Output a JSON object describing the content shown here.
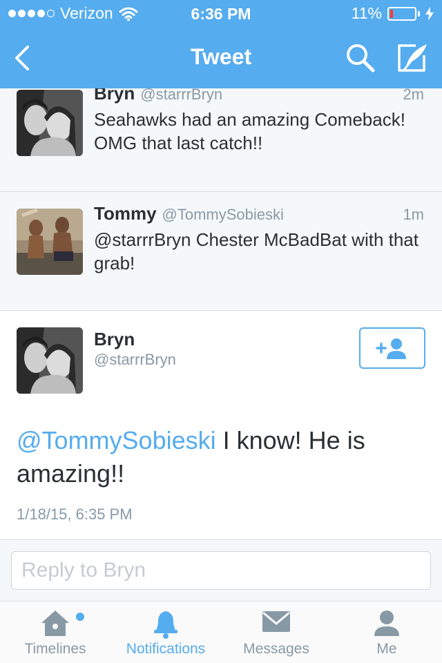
{
  "status_bar": {
    "carrier": "Verizon",
    "time": "6:36 PM",
    "battery_percent": "11%",
    "battery_level": 0.11,
    "battery_color": "#ff3b30"
  },
  "nav": {
    "title": "Tweet",
    "back_icon": "chevron-left-icon",
    "search_icon": "search-icon",
    "compose_icon": "compose-icon"
  },
  "tweets": [
    {
      "name": "Bryn",
      "handle": "@starrrBryn",
      "time": "2m",
      "text": "Seahawks had an amazing Comeback! OMG that last catch!!"
    },
    {
      "name": "Tommy",
      "handle": "@TommySobieski",
      "time": "1m",
      "text": "@starrrBryn Chester McBadBat with that grab!"
    }
  ],
  "main_tweet": {
    "name": "Bryn",
    "handle": "@starrrBryn",
    "mention": "@TommySobieski",
    "text": " I know! He is amazing!!",
    "date": "1/18/15, 6:35 PM",
    "follow_icon": "add-user-icon"
  },
  "reply": {
    "placeholder": "Reply to Bryn"
  },
  "tabs": [
    {
      "label": "Timelines",
      "icon": "home-icon",
      "has_badge": true
    },
    {
      "label": "Notifications",
      "icon": "bell-icon",
      "active": true
    },
    {
      "label": "Messages",
      "icon": "envelope-icon"
    },
    {
      "label": "Me",
      "icon": "person-icon"
    }
  ],
  "colors": {
    "brand": "#55acee",
    "text": "#292f33",
    "muted": "#8899a6"
  }
}
